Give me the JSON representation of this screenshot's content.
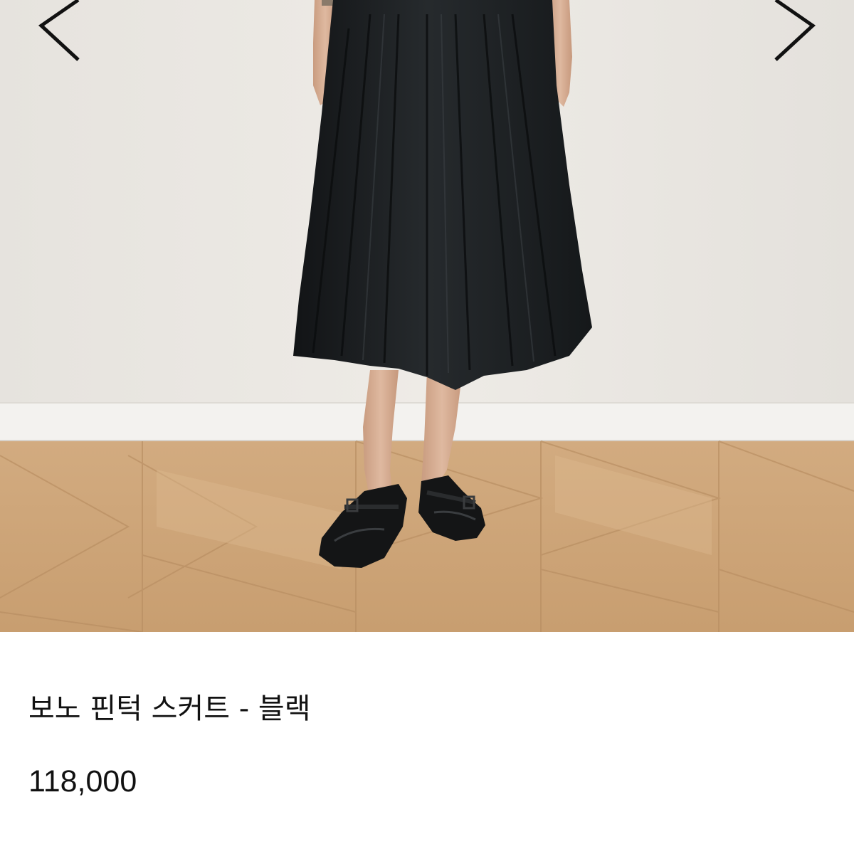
{
  "product": {
    "image_alt": "skirt-photo",
    "title": "보노 핀턱 스커트 - 블랙",
    "price": "118,000"
  },
  "gallery": {
    "prev_icon": "chevron-left-icon",
    "next_icon": "chevron-right-icon"
  },
  "colors": {
    "wall": "#ebe8e3",
    "baseboard": "#f3f2ef",
    "floor": "#cfa77a",
    "skirt": "#1c1f21",
    "skin": "#d9b39a",
    "shoe": "#141516",
    "text": "#111111"
  }
}
